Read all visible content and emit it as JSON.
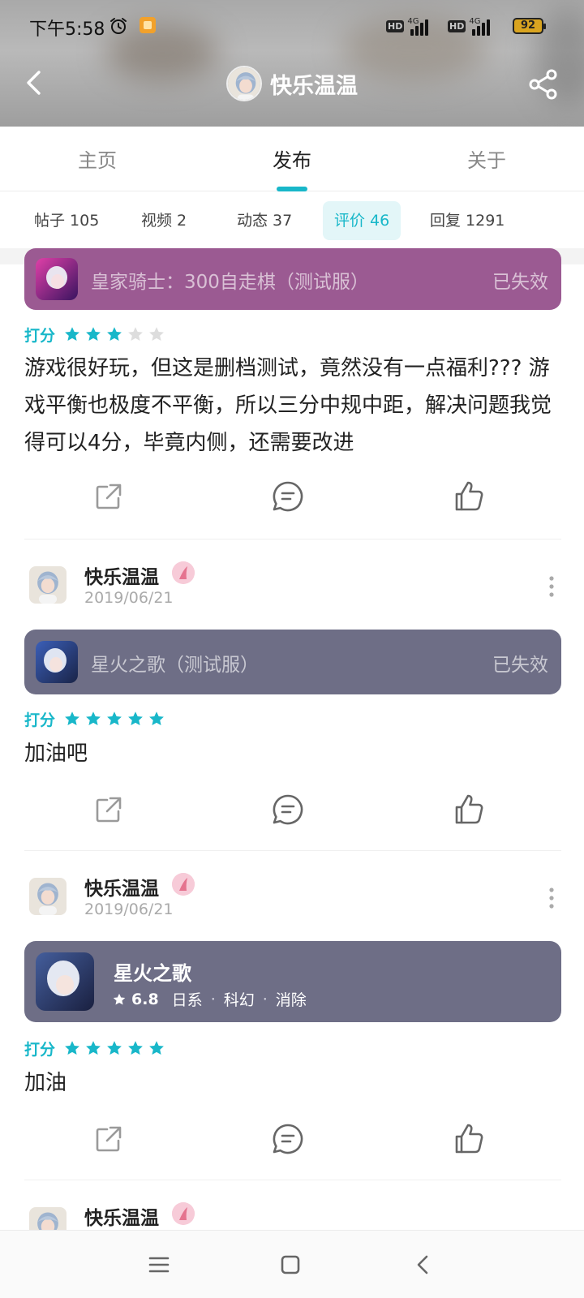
{
  "status_bar": {
    "time": "下午5:58",
    "hd1": "HD",
    "net1": "4G",
    "hd2": "HD",
    "net2": "4G",
    "battery": "92"
  },
  "header": {
    "title": "快乐温温",
    "icons": [
      "back-icon",
      "share-icon"
    ]
  },
  "tabs": {
    "items": [
      {
        "label": "主页"
      },
      {
        "label": "发布"
      },
      {
        "label": "关于"
      }
    ],
    "active": "发布"
  },
  "subtabs": {
    "items": [
      {
        "label": "帖子 105"
      },
      {
        "label": "视频 2"
      },
      {
        "label": "动态 37"
      },
      {
        "label": "评价 46"
      },
      {
        "label": "回复 1291"
      }
    ],
    "active": "评价 46"
  },
  "feed": {
    "rating_label": "打分",
    "items": [
      {
        "game": {
          "name": "皇家骑士：300自走棋（测试服）",
          "status": "已失效",
          "color": "#9b5a92"
        },
        "stars": 3,
        "text": "游戏很好玩，但这是删档测试，竟然没有一点福利??? 游戏平衡也极度不平衡，所以三分中规中距，解决问题我觉得可以4分，毕竟内侧，还需要改进"
      },
      {
        "author": {
          "name": "快乐温温",
          "date": "2019/06/21"
        },
        "game": {
          "name": "星火之歌（测试服）",
          "status": "已失效",
          "color": "#6e6e86"
        },
        "stars": 5,
        "text": "加油吧"
      },
      {
        "author": {
          "name": "快乐温温",
          "date": "2019/06/21"
        },
        "game_full": {
          "name": "星火之歌",
          "score": "6.8",
          "tags": [
            "日系",
            "科幻",
            "消除"
          ]
        },
        "stars": 5,
        "text": "加油"
      },
      {
        "author": {
          "name": "快乐温温"
        }
      }
    ],
    "action_icons": [
      "share-icon",
      "comment-icon",
      "like-icon"
    ]
  },
  "colors": {
    "accent": "#18b7c9",
    "star_empty": "#dddddd",
    "card_purple": "#9b5a92",
    "card_gray": "#6e6e86"
  },
  "nav_bar": {
    "icons": [
      "menu-icon",
      "home-icon",
      "back-icon"
    ]
  }
}
